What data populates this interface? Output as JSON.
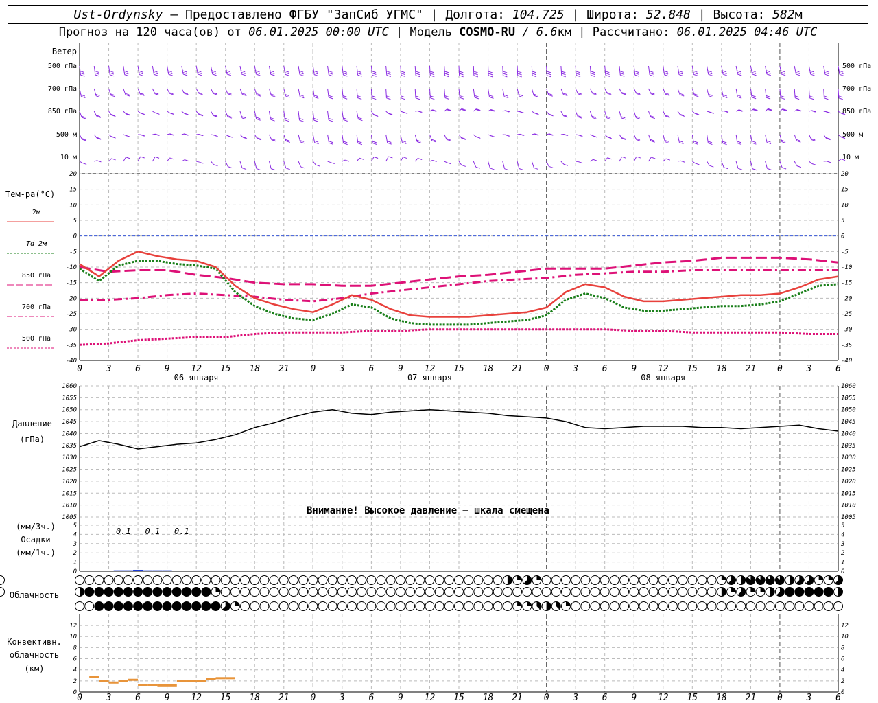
{
  "header": {
    "station": "Ust-Ordynsky",
    "provider": "Предоставлено ФГБУ \"ЗапСиб УГМС\"",
    "lon_label": "Долгота:",
    "lon_value": "104.725",
    "lat_label": "Широта:",
    "lat_value": "52.848",
    "alt_label": "Высота:",
    "alt_value": "582",
    "alt_unit": "м",
    "forecast_label": "Прогноз на 120 часа(ов) от",
    "forecast_time": "06.01.2025 00:00 UTC",
    "model_label": "Модель",
    "model_name": "COSMO-RU",
    "model_res": "6.6",
    "model_res_unit": "км",
    "calc_label": "Рассчитано:",
    "calc_time": "06.01.2025 04:46 UTC"
  },
  "chart_data": {
    "type": "meteogram",
    "x_hours": [
      0,
      3,
      6,
      9,
      12,
      15,
      18,
      21,
      24,
      27,
      30,
      33,
      36,
      39,
      42,
      45,
      48,
      51,
      54,
      57,
      60,
      63,
      66,
      69,
      72,
      75,
      78
    ],
    "x_tick_labels": [
      "0",
      "3",
      "6",
      "9",
      "12",
      "15",
      "18",
      "21",
      "0",
      "3",
      "6",
      "9",
      "12",
      "15",
      "18",
      "21",
      "0",
      "3",
      "6",
      "9",
      "12",
      "15",
      "18",
      "21",
      "0",
      "3",
      "6"
    ],
    "date_labels": [
      {
        "hour": 12,
        "text": "06 января"
      },
      {
        "hour": 36,
        "text": "07 января"
      },
      {
        "hour": 60,
        "text": "08 января"
      }
    ],
    "wind": {
      "title": "Ветер",
      "levels": [
        "500 гПа",
        "700 гПа",
        "850 гПа",
        "500 м",
        "10 м"
      ],
      "color": "#8a2be2"
    },
    "temperature": {
      "title": "Тем-ра(°C)",
      "ylim": [
        -40,
        20
      ],
      "yticks": [
        20,
        15,
        10,
        5,
        0,
        -5,
        -10,
        -15,
        -20,
        -25,
        -30,
        -35,
        -40
      ],
      "zero_line_color": "#3a5ad9",
      "series": [
        {
          "name": "2м",
          "color": "#e8413c",
          "style": "solid",
          "hours": [
            0,
            2,
            4,
            6,
            8,
            10,
            12,
            14,
            16,
            18,
            20,
            22,
            24,
            26,
            28,
            30,
            32,
            34,
            36,
            38,
            40,
            42,
            44,
            46,
            48,
            50,
            52,
            54,
            56,
            58,
            60,
            62,
            64,
            66,
            68,
            70,
            72,
            74,
            76,
            78
          ],
          "values": [
            -9,
            -13,
            -8,
            -5,
            -6.5,
            -7.5,
            -8,
            -10,
            -16,
            -20,
            -22,
            -23.5,
            -24.5,
            -22,
            -19,
            -20.5,
            -23.5,
            -25.5,
            -26,
            -26,
            -26,
            -25.5,
            -25,
            -24.5,
            -23,
            -18,
            -15.5,
            -16.5,
            -19.5,
            -21,
            -21,
            -20.5,
            -20,
            -19.5,
            -19,
            -19,
            -18.5,
            -16.5,
            -14,
            -13
          ]
        },
        {
          "name": "Td 2м",
          "color": "#1a7f1a",
          "style": "dotted",
          "hours": [
            0,
            2,
            4,
            6,
            8,
            10,
            12,
            14,
            16,
            18,
            20,
            22,
            24,
            26,
            28,
            30,
            32,
            34,
            36,
            38,
            40,
            42,
            44,
            46,
            48,
            50,
            52,
            54,
            56,
            58,
            60,
            62,
            64,
            66,
            68,
            70,
            72,
            74,
            76,
            78
          ],
          "values": [
            -10.5,
            -14.5,
            -9.5,
            -8,
            -8,
            -9,
            -9.5,
            -10.5,
            -18,
            -22.5,
            -25,
            -26.5,
            -27,
            -25,
            -22,
            -23,
            -26.5,
            -28,
            -28.5,
            -28.5,
            -28.5,
            -28,
            -27.5,
            -27,
            -25.5,
            -20.5,
            -18.5,
            -20,
            -23,
            -24,
            -24,
            -23.5,
            -23,
            -22.5,
            -22.5,
            -22,
            -21,
            -18.5,
            -16,
            -15.5
          ]
        },
        {
          "name": "850 гПа",
          "color": "#dd1177",
          "style": "longdash",
          "hours": [
            0,
            3,
            6,
            9,
            12,
            15,
            18,
            21,
            24,
            27,
            30,
            33,
            36,
            39,
            42,
            45,
            48,
            51,
            54,
            57,
            60,
            63,
            66,
            69,
            72,
            75,
            78
          ],
          "values": [
            -10,
            -11.5,
            -11,
            -11,
            -12.5,
            -13.5,
            -15,
            -15.5,
            -15.5,
            -16,
            -16,
            -15,
            -14,
            -13,
            -12.5,
            -11.5,
            -10.5,
            -10.5,
            -10.5,
            -9.5,
            -8.5,
            -8,
            -7,
            -7,
            -7,
            -7.5,
            -8.5
          ]
        },
        {
          "name": "700 гПа",
          "color": "#dd1177",
          "style": "dashdot",
          "hours": [
            0,
            3,
            6,
            9,
            12,
            15,
            18,
            21,
            24,
            27,
            30,
            33,
            36,
            39,
            42,
            45,
            48,
            51,
            54,
            57,
            60,
            63,
            66,
            69,
            72,
            75,
            78
          ],
          "values": [
            -20.5,
            -20.5,
            -20,
            -19,
            -18.5,
            -19,
            -19.5,
            -20.5,
            -21,
            -20,
            -18.5,
            -17.5,
            -16.5,
            -15.5,
            -14.5,
            -14,
            -13.5,
            -12.5,
            -12,
            -11.5,
            -11.5,
            -11,
            -11,
            -11,
            -11,
            -11,
            -11
          ]
        },
        {
          "name": "500 гПа",
          "color": "#dd1177",
          "style": "dotted",
          "hours": [
            0,
            3,
            6,
            9,
            12,
            15,
            18,
            21,
            24,
            27,
            30,
            33,
            36,
            39,
            42,
            45,
            48,
            51,
            54,
            57,
            60,
            63,
            66,
            69,
            72,
            75,
            78
          ],
          "values": [
            -35,
            -34.5,
            -33.5,
            -33,
            -32.5,
            -32.5,
            -31.5,
            -31,
            -31,
            -31,
            -30.5,
            -30.5,
            -30,
            -30,
            -30,
            -30,
            -30,
            -30,
            -30,
            -30.5,
            -30.5,
            -31,
            -31,
            -31,
            -31,
            -31.5,
            -31.5
          ]
        }
      ]
    },
    "pressure": {
      "title": "Давление",
      "unit": "(гПа)",
      "ylim": [
        1005,
        1060
      ],
      "yticks": [
        1060,
        1055,
        1050,
        1045,
        1040,
        1035,
        1030,
        1025,
        1020,
        1015,
        1010,
        1005
      ],
      "warning": "Внимание! Высокое давление — шкала смещена",
      "color": "#000000",
      "hours": [
        0,
        2,
        4,
        6,
        8,
        10,
        12,
        14,
        16,
        18,
        20,
        22,
        24,
        26,
        28,
        30,
        32,
        34,
        36,
        38,
        40,
        42,
        44,
        46,
        48,
        50,
        52,
        54,
        56,
        58,
        60,
        62,
        64,
        66,
        68,
        70,
        72,
        74,
        76,
        78
      ],
      "values": [
        1034.5,
        1037,
        1035.5,
        1033.5,
        1034.5,
        1035.5,
        1036,
        1037.5,
        1039.5,
        1042.5,
        1044.5,
        1047,
        1049,
        1050,
        1048.5,
        1048,
        1049,
        1049.5,
        1050,
        1049.5,
        1049,
        1048.5,
        1047.5,
        1047,
        1046.5,
        1045,
        1042.5,
        1042,
        1042.5,
        1043,
        1043,
        1043,
        1042.5,
        1042.5,
        1042,
        1042.5,
        1043,
        1043.5,
        1042,
        1041
      ]
    },
    "precipitation": {
      "title": "Осадки",
      "unit_3h": "(мм/3ч.)",
      "unit_1h": "(мм/1ч.)",
      "ylim": [
        0,
        5
      ],
      "yticks": [
        5,
        4,
        3,
        2,
        1,
        0
      ],
      "labels": [
        {
          "hour": 4.5,
          "text": "0.1"
        },
        {
          "hour": 7.5,
          "text": "0.1"
        },
        {
          "hour": 10.5,
          "text": "0.1"
        }
      ],
      "hours": [
        3,
        4,
        5,
        6,
        7,
        8,
        9,
        10
      ],
      "values": [
        0.05,
        0.1,
        0.1,
        0.15,
        0.1,
        0.1,
        0.1,
        0.05
      ],
      "color": "#1a3ad9"
    },
    "cloudiness": {
      "title": "Облачность",
      "hours": [
        0,
        1,
        2,
        3,
        4,
        5,
        6,
        7,
        8,
        9,
        10,
        11,
        12,
        13,
        14,
        15,
        16,
        17,
        18,
        19,
        20,
        21,
        22,
        23,
        24,
        25,
        26,
        27,
        28,
        29,
        30,
        31,
        32,
        33,
        34,
        35,
        36,
        37,
        38,
        39,
        40,
        41,
        42,
        43,
        44,
        45,
        46,
        47,
        48,
        49,
        50,
        51,
        52,
        53,
        54,
        55,
        56,
        57,
        58,
        59,
        60,
        61,
        62,
        63,
        64,
        65,
        66,
        67,
        68,
        69,
        70,
        71,
        72,
        73,
        74,
        75,
        76,
        77,
        78
      ],
      "rows": [
        [
          0,
          0,
          0,
          0,
          0,
          0,
          0,
          0,
          0,
          0,
          0,
          0,
          0,
          0,
          0,
          0,
          0,
          0,
          0,
          0,
          0,
          0,
          0,
          0,
          0,
          0,
          0,
          0,
          0,
          0,
          0,
          0,
          0,
          0,
          0,
          0,
          0,
          0,
          0,
          0,
          0,
          0,
          0,
          0,
          4,
          2,
          5,
          2,
          0,
          0,
          0,
          0,
          0,
          0,
          0,
          0,
          0,
          0,
          0,
          0,
          0,
          0,
          0,
          0,
          0,
          0,
          2,
          5,
          4,
          7,
          7,
          7,
          7,
          4,
          5,
          5,
          2,
          2,
          5,
          6
        ],
        [
          4,
          8,
          8,
          8,
          8,
          8,
          8,
          8,
          8,
          8,
          8,
          8,
          8,
          8,
          2,
          0,
          0,
          0,
          0,
          0,
          0,
          0,
          0,
          0,
          0,
          0,
          0,
          0,
          0,
          0,
          0,
          0,
          0,
          0,
          0,
          0,
          0,
          0,
          0,
          0,
          0,
          0,
          0,
          0,
          0,
          0,
          0,
          0,
          0,
          0,
          0,
          0,
          0,
          0,
          0,
          0,
          0,
          0,
          0,
          0,
          0,
          0,
          0,
          0,
          0,
          0,
          4,
          2,
          5,
          2,
          2,
          4,
          5,
          8,
          8,
          8,
          8,
          8,
          4,
          4
        ],
        [
          0,
          0,
          8,
          8,
          8,
          8,
          8,
          8,
          8,
          8,
          8,
          8,
          8,
          8,
          8,
          5,
          2,
          0,
          0,
          0,
          0,
          0,
          0,
          0,
          0,
          0,
          0,
          0,
          0,
          0,
          0,
          0,
          0,
          0,
          0,
          0,
          0,
          0,
          0,
          0,
          0,
          0,
          0,
          0,
          0,
          2,
          2,
          3,
          4,
          3,
          2,
          0,
          0,
          0,
          0,
          0,
          0,
          0,
          0,
          0,
          0,
          0,
          0,
          0,
          0,
          0,
          0,
          0,
          0,
          0,
          0,
          0,
          0,
          0,
          0,
          0,
          0,
          0,
          0
        ]
      ]
    },
    "convective": {
      "title1": "Конвективн.",
      "title2": "облачность",
      "unit": "(км)",
      "ylim": [
        0,
        13
      ],
      "yticks": [
        12,
        10,
        8,
        6,
        4,
        2,
        0
      ],
      "color": "#e8943a",
      "segments": [
        {
          "h0": 1,
          "h1": 2,
          "base": 2.7
        },
        {
          "h0": 2,
          "h1": 3,
          "base": 2.0
        },
        {
          "h0": 3,
          "h1": 4,
          "base": 1.7
        },
        {
          "h0": 4,
          "h1": 5,
          "base": 2.0
        },
        {
          "h0": 5,
          "h1": 6,
          "base": 2.2
        },
        {
          "h0": 6,
          "h1": 7,
          "base": 1.3
        },
        {
          "h0": 7,
          "h1": 8,
          "base": 1.3
        },
        {
          "h0": 8,
          "h1": 9,
          "base": 1.2
        },
        {
          "h0": 9,
          "h1": 10,
          "base": 1.2
        },
        {
          "h0": 10,
          "h1": 11,
          "base": 2.0
        },
        {
          "h0": 11,
          "h1": 12,
          "base": 2.0
        },
        {
          "h0": 12,
          "h1": 13,
          "base": 2.0
        },
        {
          "h0": 13,
          "h1": 14,
          "base": 2.3
        },
        {
          "h0": 14,
          "h1": 15,
          "base": 2.5
        },
        {
          "h0": 15,
          "h1": 16,
          "base": 2.5
        }
      ]
    }
  }
}
